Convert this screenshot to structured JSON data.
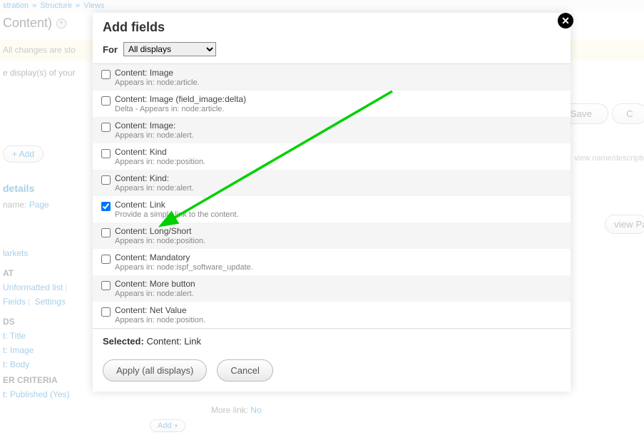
{
  "breadcrumb": [
    "stration",
    "Structure",
    "Views"
  ],
  "page_title_suffix": "Content)",
  "changes_msg": "All changes are sto",
  "displays_msg": "e display(s) of your",
  "save_label": "Save",
  "cancel_bg_label": "C",
  "viewname_hint": "view name/descriptio",
  "view_page_label": "view Pag",
  "add_label": "+ Add",
  "sidebar": {
    "details_heading": "details",
    "name_label": "name:",
    "name_value": "Page",
    "markets": "larkets",
    "at_heading": "AT",
    "unformatted": "Unformatted list",
    "fields": "Fields",
    "settings": "Settings",
    "ds_heading": "DS",
    "title": "t: Title",
    "image": "t: Image",
    "body": "t: Body",
    "criteria_heading": "ER CRITERIA",
    "published": "t: Published (Yes)",
    "add_small": "Add"
  },
  "more_link": {
    "label": "More link:",
    "value": "No"
  },
  "modal": {
    "title": "Add fields",
    "for_label": "For",
    "for_value": "All displays",
    "selected_label": "Selected:",
    "selected_value": "Content: Link",
    "apply_label": "Apply (all displays)",
    "cancel_label": "Cancel"
  },
  "fields": [
    {
      "label": "Content: Image",
      "desc": "Appears in: node:article.",
      "checked": false
    },
    {
      "label": "Content: Image (field_image:delta)",
      "desc": "Delta - Appears in: node:article.",
      "checked": false
    },
    {
      "label": "Content: Image:",
      "desc": "Appears in: node:alert.",
      "checked": false
    },
    {
      "label": "Content: Kind",
      "desc": "Appears in: node:position.",
      "checked": false
    },
    {
      "label": "Content: Kind:",
      "desc": "Appears in: node:alert.",
      "checked": false
    },
    {
      "label": "Content: Link",
      "desc": "Provide a simple link to the content.",
      "checked": true
    },
    {
      "label": "Content: Long/Short",
      "desc": "Appears in: node:position.",
      "checked": false
    },
    {
      "label": "Content: Mandatory",
      "desc": "Appears in: node:ispf_software_update.",
      "checked": false
    },
    {
      "label": "Content: More button",
      "desc": "Appears in: node:alert.",
      "checked": false
    },
    {
      "label": "Content: Net Value",
      "desc": "Appears in: node:position.",
      "checked": false
    }
  ]
}
